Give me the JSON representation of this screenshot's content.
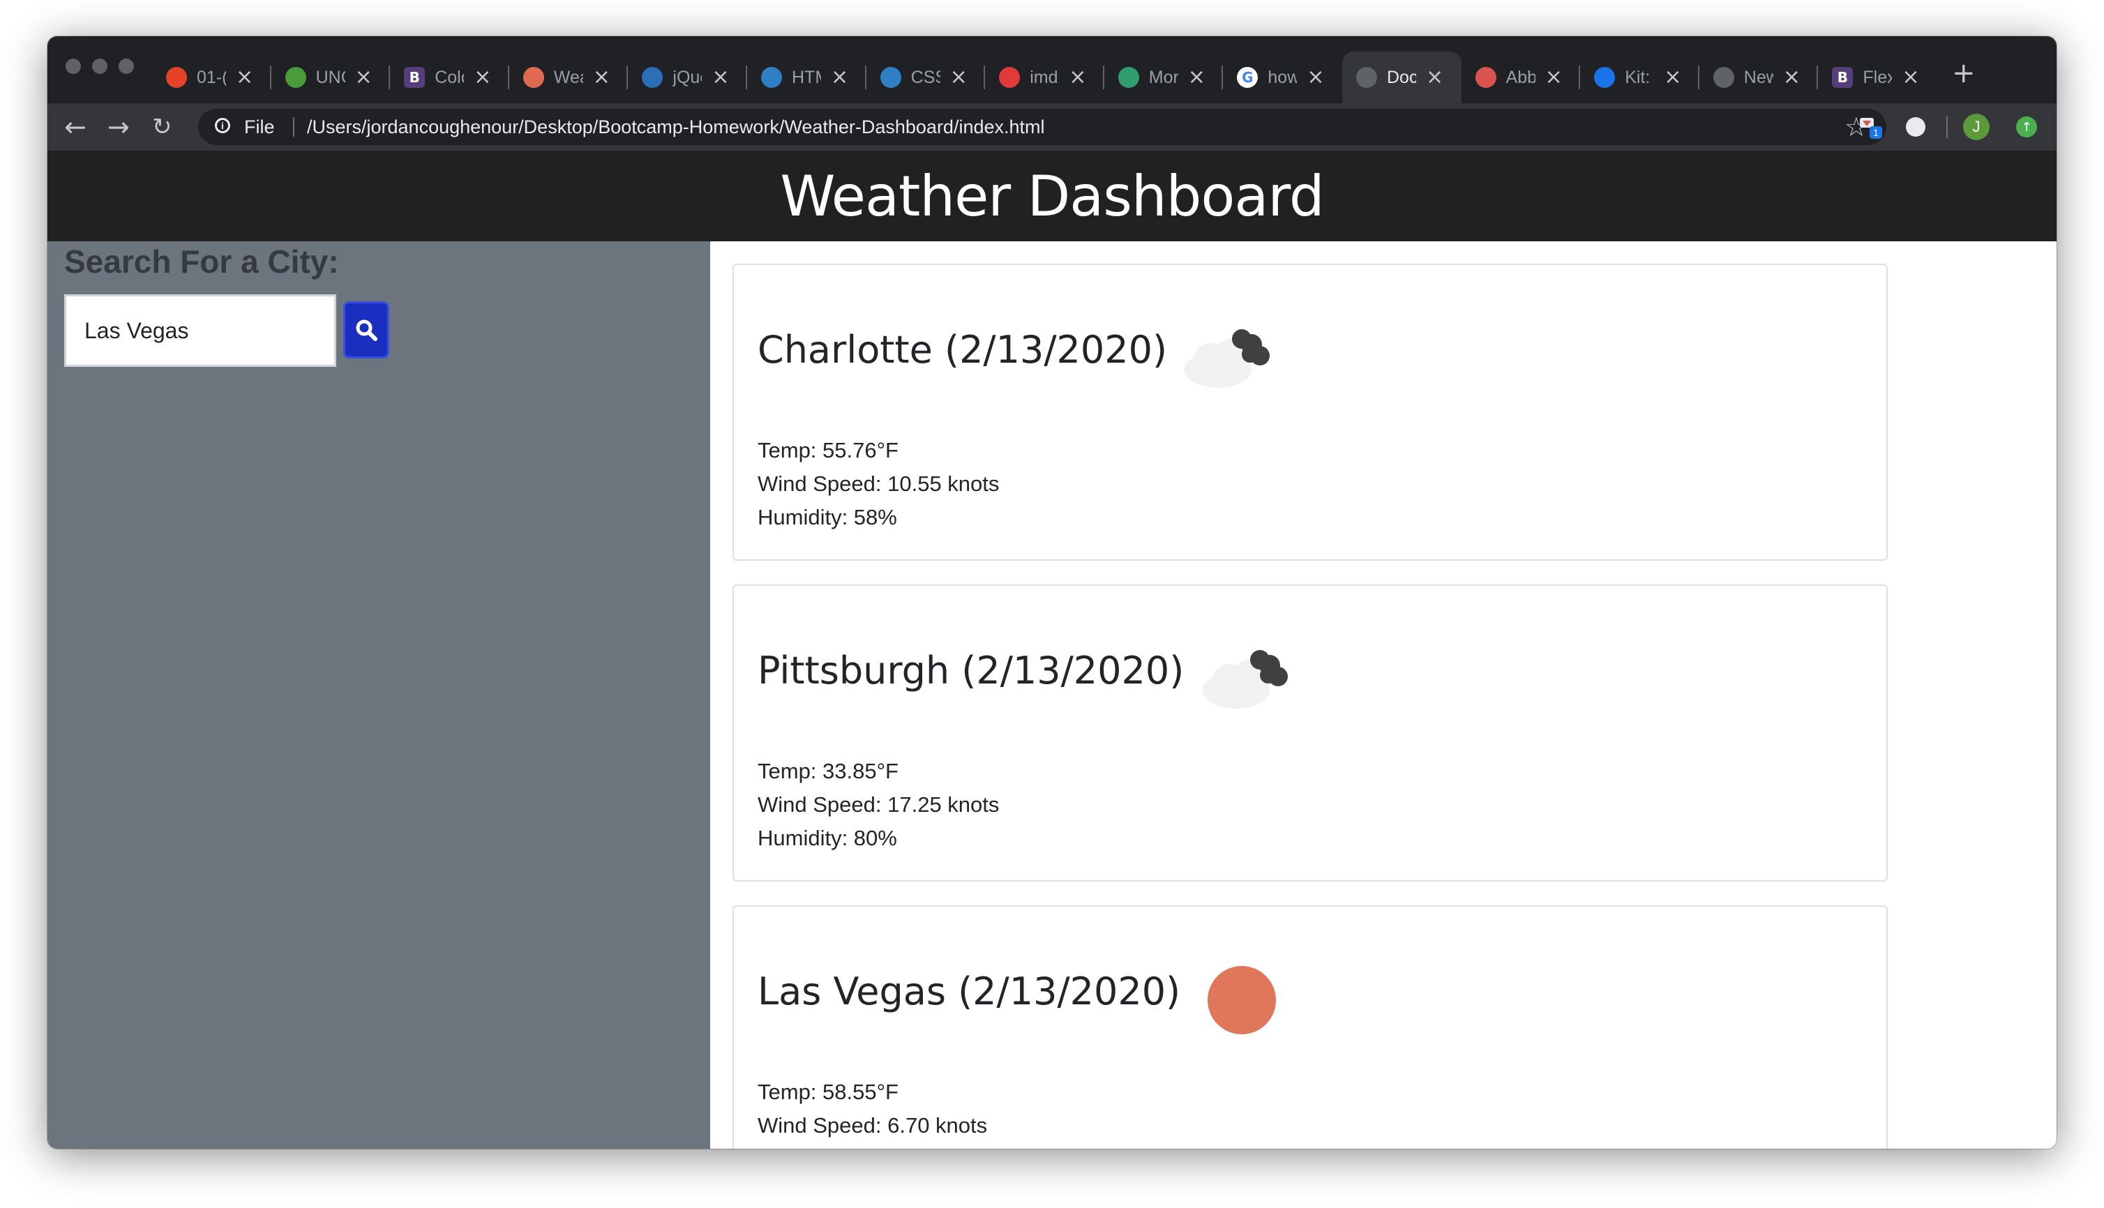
{
  "browser": {
    "tabs": [
      {
        "title": "01-(",
        "favicon": "gitlab-icon",
        "color": "#e24329"
      },
      {
        "title": "UNC",
        "favicon": "unc-icon",
        "color": "#4a9b3c"
      },
      {
        "title": "Colo",
        "favicon": "bootstrap-icon",
        "color": "#563d7c",
        "glyph": "B"
      },
      {
        "title": "Wea",
        "favicon": "weather-icon",
        "color": "#e06a50"
      },
      {
        "title": "jQue",
        "favicon": "jquery-icon",
        "color": "#2a6fb8"
      },
      {
        "title": "HTM",
        "favicon": "w3schools-icon",
        "color": "#2f7fc4"
      },
      {
        "title": "CSS",
        "favicon": "w3schools-icon",
        "color": "#2f7fc4"
      },
      {
        "title": "imdb",
        "favicon": "imdb-icon",
        "color": "#e03a3a"
      },
      {
        "title": "Mor",
        "favicon": "clock-icon",
        "color": "#2f9e6e"
      },
      {
        "title": "how",
        "favicon": "google-icon",
        "color": "#4285f4",
        "glyph": "G"
      },
      {
        "title": "Doc",
        "favicon": "globe-icon",
        "color": "#5f6368"
      },
      {
        "title": "Abb",
        "favicon": "abbey-icon",
        "color": "#d9534f"
      },
      {
        "title": "Kit:",
        "favicon": "flag-icon",
        "color": "#1a73e8"
      },
      {
        "title": "New",
        "favicon": "globe-icon",
        "color": "#5f6368"
      },
      {
        "title": "Flex",
        "favicon": "bootstrap-icon",
        "color": "#563d7c",
        "glyph": "B"
      }
    ],
    "active_tab": 10,
    "url_scheme": "File",
    "url": "/Users/jordancoughenour/Desktop/Bootcamp-Homework/Weather-Dashboard/index.html",
    "profile_initial": "J",
    "extension_badge": "1"
  },
  "app": {
    "title": "Weather Dashboard",
    "search": {
      "heading": "Search For a City:",
      "value": "Las Vegas"
    },
    "cards": [
      {
        "city": "Charlotte (2/13/2020)",
        "icon": "cloudy-icon",
        "temp": "Temp: 55.76°F",
        "wind": "Wind Speed: 10.55 knots",
        "humidity": "Humidity: 58%"
      },
      {
        "city": "Pittsburgh (2/13/2020)",
        "icon": "cloudy-icon",
        "temp": "Temp: 33.85°F",
        "wind": "Wind Speed: 17.25 knots",
        "humidity": "Humidity: 80%"
      },
      {
        "city": "Las Vegas (2/13/2020)",
        "icon": "sun-icon",
        "temp": "Temp: 58.55°F",
        "wind": "Wind Speed: 6.70 knots",
        "humidity": ""
      }
    ]
  },
  "colors": {
    "header_bg": "#212121",
    "sidebar_bg": "#6c757d",
    "search_button": "#1a2fbf",
    "sun": "#e0765a"
  }
}
